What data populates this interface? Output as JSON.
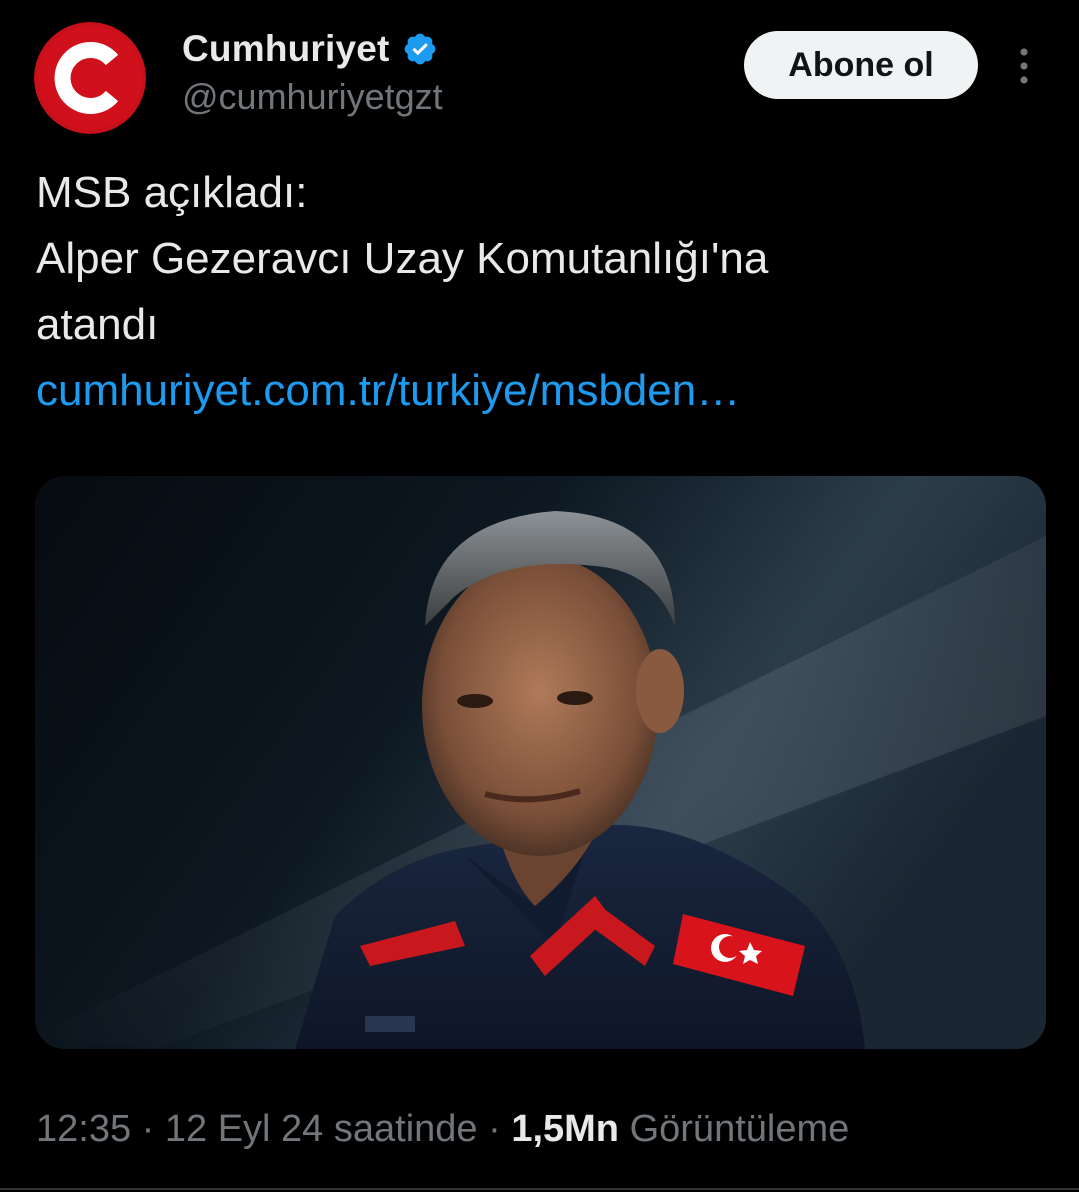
{
  "author": {
    "display_name": "Cumhuriyet",
    "handle": "@cumhuriyetgzt",
    "verified": true,
    "avatar_icon": "cumhuriyet-c-logo",
    "avatar_color": "#d0111b",
    "verified_color": "#1d9bf0"
  },
  "actions": {
    "follow_label": "Abone ol",
    "more_icon": "vertical-ellipsis-icon"
  },
  "tweet": {
    "lines": [
      "MSB açıkladı:",
      "Alper Gezeravcı Uzay Komutanlığı'na",
      "atandı"
    ],
    "link_text": "cumhuriyet.com.tr/turkiye/msbden…",
    "link_color": "#1d9bf0"
  },
  "media": {
    "description_icon": "portrait-photo"
  },
  "meta": {
    "time": "12:35",
    "sep1": " · ",
    "date": "12 Eyl 24 saatinde",
    "sep2": " · ",
    "views_count": "1,5Mn",
    "views_label": " Görüntüleme"
  }
}
